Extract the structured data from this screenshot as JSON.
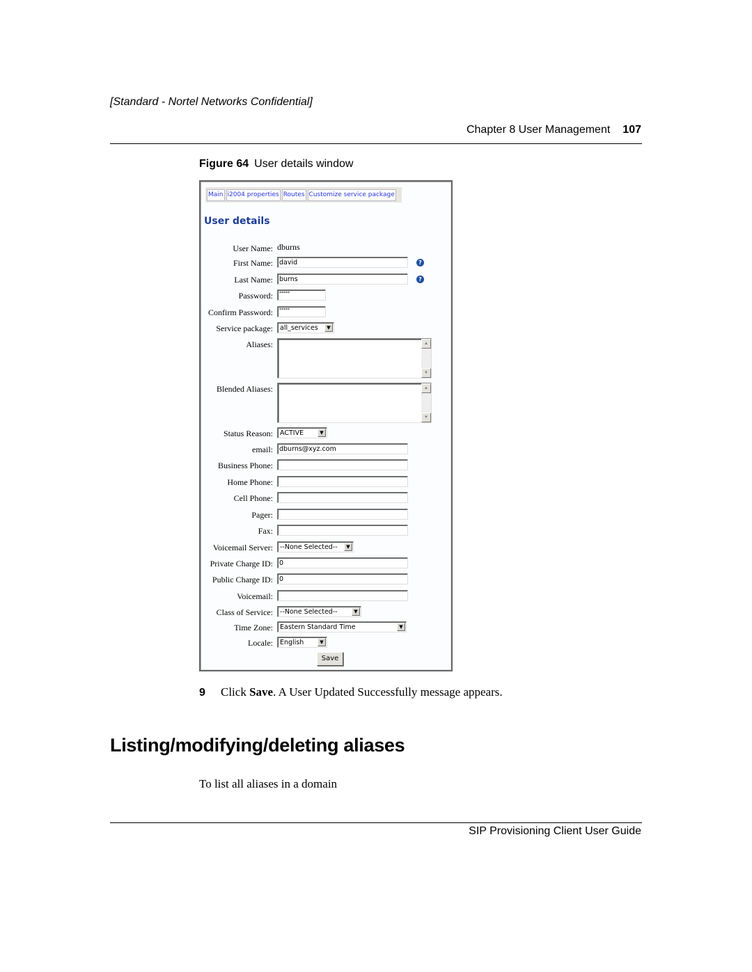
{
  "page": {
    "confidential": "[Standard - Nortel Networks Confidential]",
    "chapter": "Chapter 8  User Management",
    "page_number": "107",
    "figure_label": "Figure 64",
    "figure_title": "User details window",
    "step_number": "9",
    "step_text_pre": "Click ",
    "step_text_bold": "Save",
    "step_text_post": ". A User Updated Successfully message appears.",
    "section_heading": "Listing/modifying/deleting aliases",
    "body_text": "To list all aliases in a domain",
    "footer": "SIP Provisioning Client User Guide"
  },
  "ui": {
    "tabs": [
      "Main",
      "i2004 properties",
      "Routes",
      "Customize service package"
    ],
    "title": "User details",
    "help_icon": "?",
    "fields": {
      "user_name": {
        "label": "User Name:",
        "value": "dburns"
      },
      "first_name": {
        "label": "First Name:",
        "value": "david"
      },
      "last_name": {
        "label": "Last Name:",
        "value": "burns"
      },
      "password": {
        "label": "Password:",
        "value": "*****"
      },
      "confirm_password": {
        "label": "Confirm Password:",
        "value": "*****"
      },
      "service_package": {
        "label": "Service package:",
        "value": "all_services"
      },
      "aliases": {
        "label": "Aliases:",
        "value": ""
      },
      "blended_aliases": {
        "label": "Blended Aliases:",
        "value": ""
      },
      "status_reason": {
        "label": "Status Reason:",
        "value": "ACTIVE"
      },
      "email": {
        "label": "email:",
        "value": "dburns@xyz.com"
      },
      "business_phone": {
        "label": "Business Phone:",
        "value": ""
      },
      "home_phone": {
        "label": "Home Phone:",
        "value": ""
      },
      "cell_phone": {
        "label": "Cell Phone:",
        "value": ""
      },
      "pager": {
        "label": "Pager:",
        "value": ""
      },
      "fax": {
        "label": "Fax:",
        "value": ""
      },
      "voicemail_server": {
        "label": "Voicemail Server:",
        "value": "--None Selected--"
      },
      "private_charge_id": {
        "label": "Private Charge ID:",
        "value": "0"
      },
      "public_charge_id": {
        "label": "Public Charge ID:",
        "value": "0"
      },
      "voicemail": {
        "label": "Voicemail:",
        "value": ""
      },
      "class_of_service": {
        "label": "Class of Service:",
        "value": "--None Selected--"
      },
      "time_zone": {
        "label": "Time Zone:",
        "value": "Eastern Standard Time"
      },
      "locale": {
        "label": "Locale:",
        "value": "English"
      }
    },
    "save_label": "Save"
  }
}
